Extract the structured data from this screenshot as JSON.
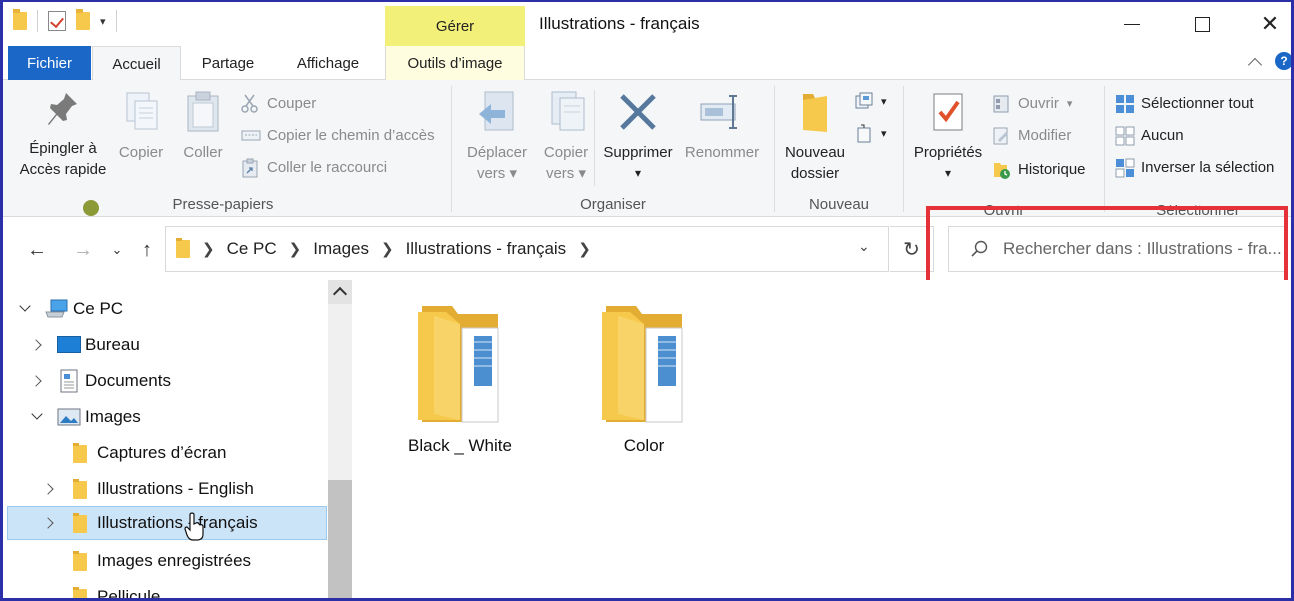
{
  "window": {
    "title": "Illustrations - français",
    "context_group": "Gérer"
  },
  "tabs": {
    "file": "Fichier",
    "home": "Accueil",
    "share": "Partage",
    "view": "Affichage",
    "picture_tools": "Outils d’image"
  },
  "ribbon": {
    "clipboard": {
      "label": "Presse-papiers",
      "pin_line1": "Épingler à",
      "pin_line2": "Accès rapide",
      "copy": "Copier",
      "paste": "Coller",
      "cut": "Couper",
      "copy_path": "Copier le chemin d’accès",
      "paste_shortcut": "Coller le raccourci"
    },
    "organize": {
      "label": "Organiser",
      "move_line1": "Déplacer",
      "move_line2": "vers",
      "copy_line1": "Copier",
      "copy_line2": "vers",
      "delete": "Supprimer",
      "rename": "Renommer"
    },
    "new": {
      "label": "Nouveau",
      "new_folder_line1": "Nouveau",
      "new_folder_line2": "dossier"
    },
    "open": {
      "label": "Ouvrir",
      "properties": "Propriétés",
      "open": "Ouvrir",
      "edit": "Modifier",
      "history": "Historique"
    },
    "select": {
      "label": "Sélectionner",
      "select_all": "Sélectionner tout",
      "select_none": "Aucun",
      "invert": "Inverser la sélection"
    }
  },
  "address": {
    "crumbs": [
      "Ce PC",
      "Images",
      "Illustrations - français"
    ]
  },
  "search": {
    "placeholder": "Rechercher dans : Illustrations - fra..."
  },
  "nav": {
    "items": [
      {
        "label": "Ce PC"
      },
      {
        "label": "Bureau"
      },
      {
        "label": "Documents"
      },
      {
        "label": "Images"
      },
      {
        "label": "Captures d’écran"
      },
      {
        "label": "Illustrations - English"
      },
      {
        "label": "Illustrations - français"
      },
      {
        "label": "Images enregistrées"
      },
      {
        "label": "Pellicule"
      }
    ]
  },
  "content": {
    "folders": [
      {
        "name": "Black _ White"
      },
      {
        "name": "Color"
      }
    ]
  },
  "colors": {
    "file_tab": "#1a67c7",
    "context_tab": "#f3f07a",
    "selection": "#cce4f7",
    "highlight_box": "#e53238",
    "folder": "#f6c94c"
  }
}
